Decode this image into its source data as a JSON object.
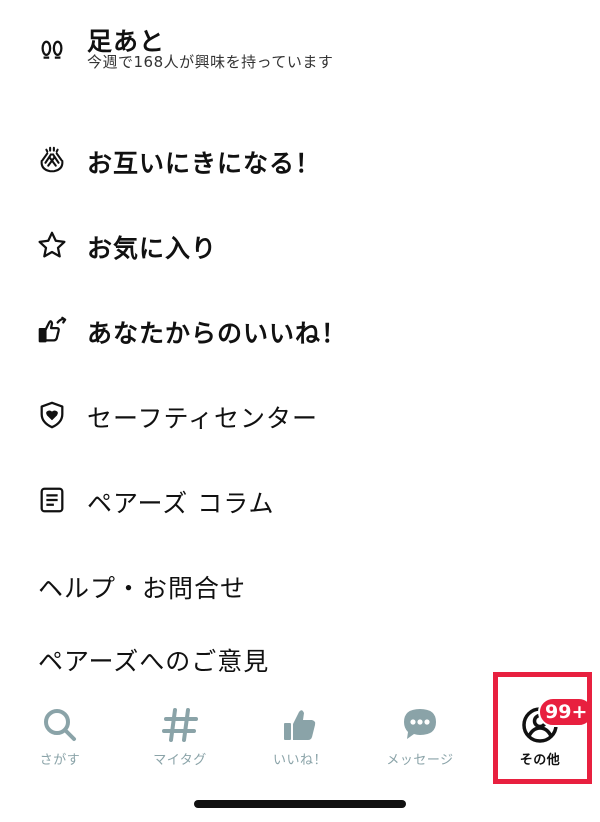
{
  "menu": {
    "footprints": {
      "label": "足あと",
      "sub": "今週で168人が興味を持っています",
      "icon": "footprints-icon"
    },
    "mutual": {
      "label": "お互いにきになる！",
      "icon": "clapping-hands-icon"
    },
    "favorites": {
      "label": "お気に入り",
      "icon": "star-icon"
    },
    "likes_from_you": {
      "label": "あなたからのいいね！",
      "icon": "thumbs-up-arrow-icon"
    },
    "safety": {
      "label": "セーフティセンター",
      "icon": "shield-heart-icon"
    },
    "column": {
      "label": "ペアーズ コラム",
      "icon": "document-icon"
    },
    "help": {
      "label": "ヘルプ・お問合せ"
    },
    "feedback": {
      "label": "ペアーズへのご意見"
    }
  },
  "tabs": [
    {
      "label": "さがす",
      "icon": "search-icon"
    },
    {
      "label": "マイタグ",
      "icon": "hashtag-icon"
    },
    {
      "label": "いいね！",
      "icon": "thumbs-up-icon"
    },
    {
      "label": "メッセージ",
      "icon": "chat-bubble-icon"
    },
    {
      "label": "その他",
      "icon": "profile-icon",
      "active": true
    }
  ],
  "badge": "99+",
  "colors": {
    "accent_red": "#e8203f",
    "tab_inactive": "#8aa3a8",
    "text": "#111111"
  }
}
